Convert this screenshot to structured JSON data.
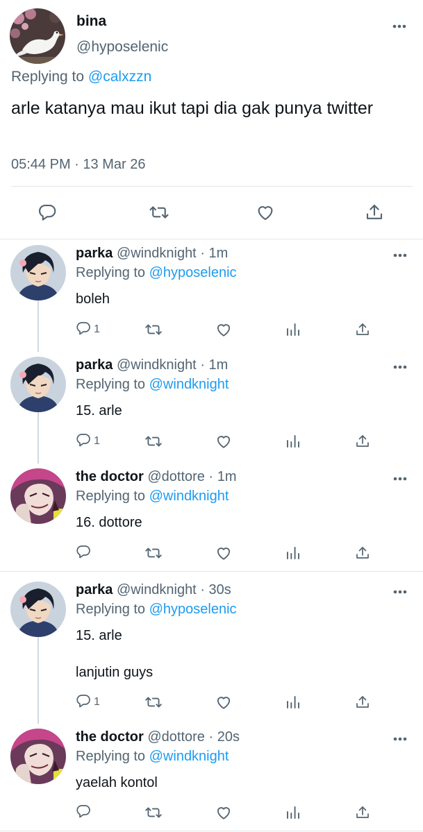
{
  "main_tweet": {
    "name": "bina",
    "handle": "@hyposelenic",
    "replying_prefix": "Replying to",
    "replying_to": "@calxzzn",
    "text": "arle katanya mau ikut tapi dia gak punya twitter",
    "time": "05:44 PM",
    "date_sep": "·",
    "date": "13 Mar 26"
  },
  "replies": [
    {
      "name": "parka",
      "handle": "@windknight",
      "sep": "·",
      "time": "1m",
      "replying_prefix": "Replying to",
      "replying_to": "@hyposelenic",
      "text": [
        "boleh"
      ],
      "reply_count": "1"
    },
    {
      "name": "parka",
      "handle": "@windknight",
      "sep": "·",
      "time": "1m",
      "replying_prefix": "Replying to",
      "replying_to": "@windknight",
      "text": [
        "15. arle"
      ],
      "reply_count": "1"
    },
    {
      "name": "the doctor",
      "handle": "@dottore",
      "sep": "·",
      "time": "1m",
      "replying_prefix": "Replying to",
      "replying_to": "@windknight",
      "text": [
        "16. dottore"
      ],
      "reply_count": ""
    },
    {
      "name": "parka",
      "handle": "@windknight",
      "sep": "·",
      "time": "30s",
      "replying_prefix": "Replying to",
      "replying_to": "@hyposelenic",
      "text": [
        "15. arle",
        "lanjutin guys"
      ],
      "reply_count": "1"
    },
    {
      "name": "the doctor",
      "handle": "@dottore",
      "sep": "·",
      "time": "20s",
      "replying_prefix": "Replying to",
      "replying_to": "@windknight",
      "text": [
        "yaelah kontol"
      ],
      "reply_count": ""
    }
  ],
  "icons": [
    "more-icon",
    "reply-icon",
    "retweet-icon",
    "like-icon",
    "share-icon",
    "analytics-icon"
  ],
  "colors": {
    "link": "#1d9bf0",
    "secondary_text": "#536471",
    "divider": "#e3e6e8"
  }
}
